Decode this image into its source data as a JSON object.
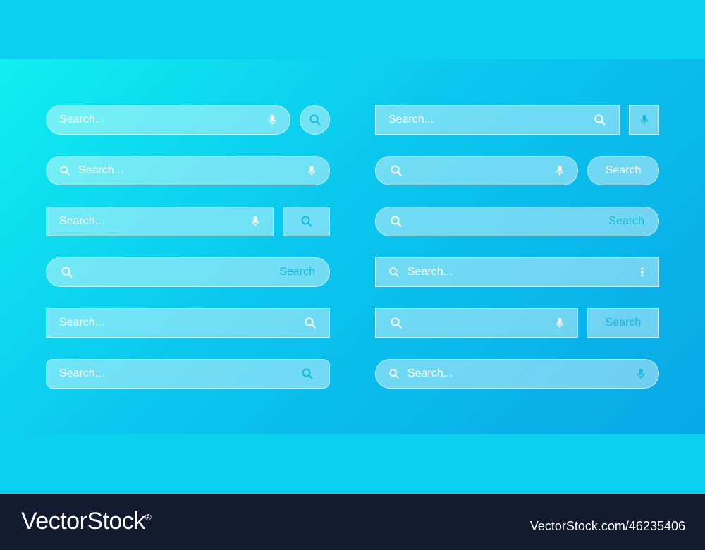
{
  "colors": {
    "panel_start": "#10eef1",
    "panel_end": "#08a8e7",
    "band": "#0cd0ef",
    "footer": "#111a2e",
    "accent_text": "#16b9dc",
    "white": "#ffffff"
  },
  "search": {
    "placeholder": "Search...",
    "button_label": "Search"
  },
  "icons": {
    "search": "search-icon",
    "mic": "microphone-icon",
    "more": "more-vertical-icon"
  },
  "watermark": {
    "logo": "VectorStock",
    "reg": "®",
    "id": "VectorStock.com/46235406"
  }
}
